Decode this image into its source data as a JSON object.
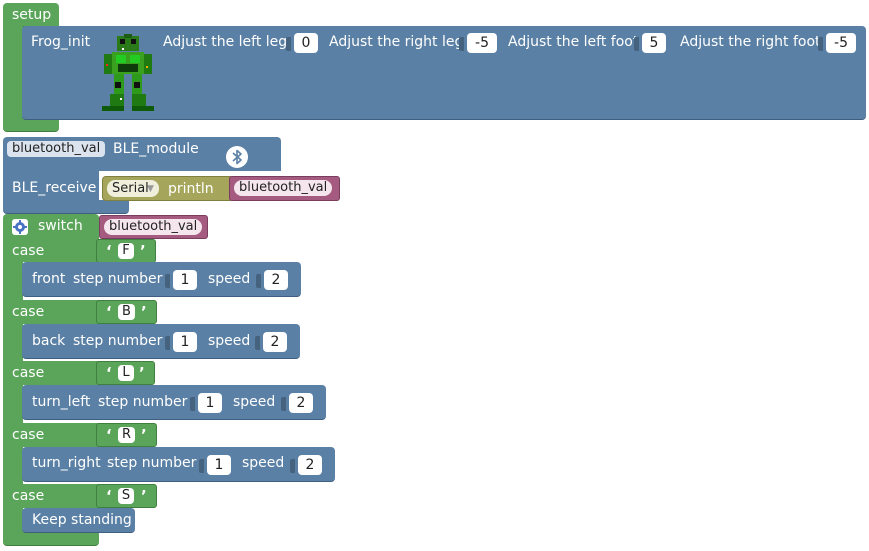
{
  "setup": {
    "hat_label": "setup",
    "init_label": "Frog_init",
    "params": [
      {
        "label": "Adjust the left leg",
        "value": "0"
      },
      {
        "label": "Adjust the right leg",
        "value": "-5"
      },
      {
        "label": "Adjust the left foot",
        "value": "5"
      },
      {
        "label": "Adjust the right foot",
        "value": "-5"
      }
    ]
  },
  "ble": {
    "var_label": "bluetooth_val",
    "module_label": "BLE_module",
    "bluetooth_icon": "bluetooth-icon",
    "receive_label": "BLE_receive",
    "serial_label": "Serial",
    "println_label": "println",
    "println_var": "bluetooth_val"
  },
  "switch_block": {
    "gear_icon": "gear-icon",
    "label": "switch",
    "var": "bluetooth_val",
    "cases": [
      {
        "case_label": "case",
        "char": "F",
        "action": "front",
        "step_label": "step number",
        "step": "1",
        "speed_label": "speed",
        "speed": "2"
      },
      {
        "case_label": "case",
        "char": "B",
        "action": "back",
        "step_label": "step number",
        "step": "1",
        "speed_label": "speed",
        "speed": "2"
      },
      {
        "case_label": "case",
        "char": "L",
        "action": "turn_left",
        "step_label": "step number",
        "step": "1",
        "speed_label": "speed",
        "speed": "2"
      },
      {
        "case_label": "case",
        "char": "R",
        "action": "turn_right",
        "step_label": "step number",
        "step": "1",
        "speed_label": "speed",
        "speed": "2"
      },
      {
        "case_label": "case",
        "char": "S",
        "action": "Keep standing"
      }
    ]
  },
  "colors": {
    "green": "#5ba55b",
    "blue": "#5b80a5",
    "pink": "#a55b80",
    "olive": "#a5a55b"
  }
}
